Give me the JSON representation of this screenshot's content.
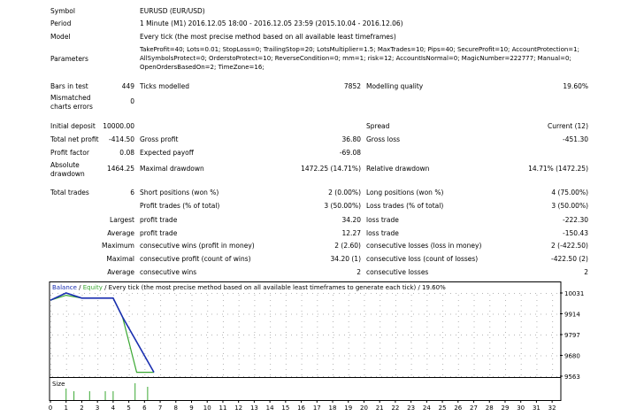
{
  "header": {
    "symbol_label": "Symbol",
    "symbol_value": "EURUSD (EUR/USD)",
    "period_label": "Period",
    "period_value": "1 Minute (M1) 2016.12.05 18:00 - 2016.12.05 23:59 (2015.10.04 - 2016.12.06)",
    "model_label": "Model",
    "model_value": "Every tick (the most precise method based on all available least timeframes)",
    "parameters_label": "Parameters",
    "parameters_value": "TakeProfit=40; Lots=0.01; StopLoss=0; TrailingStop=20; LotsMultiplier=1.5; MaxTrades=10; Pips=40; SecureProfit=10; AccountProtection=1; AllSymbolsProtect=0; OrderstoProtect=10; ReverseCondition=0; mm=1; risk=12; AccountIsNormal=0; MagicNumber=222777; Manual=0; OpenOrdersBasedOn=2; TimeZone=16;"
  },
  "bars": {
    "bars_label": "Bars in test",
    "bars_value": "449",
    "ticks_label": "Ticks modelled",
    "ticks_value": "7852",
    "quality_label": "Modelling quality",
    "quality_value": "19.60%",
    "mismatched_label": "Mismatched charts errors",
    "mismatched_value": "0"
  },
  "stats": {
    "initial_deposit_label": "Initial deposit",
    "initial_deposit_value": "10000.00",
    "spread_label": "Spread",
    "spread_value": "Current (12)",
    "net_profit_label": "Total net profit",
    "net_profit_value": "-414.50",
    "gross_profit_label": "Gross profit",
    "gross_profit_value": "36.80",
    "gross_loss_label": "Gross loss",
    "gross_loss_value": "-451.30",
    "profit_factor_label": "Profit factor",
    "profit_factor_value": "0.08",
    "expected_payoff_label": "Expected payoff",
    "expected_payoff_value": "-69.08",
    "abs_dd_label": "Absolute drawdown",
    "abs_dd_value": "1464.25",
    "max_dd_label": "Maximal drawdown",
    "max_dd_value": "1472.25 (14.71%)",
    "rel_dd_label": "Relative drawdown",
    "rel_dd_value": "14.71% (1472.25)",
    "total_trades_label": "Total trades",
    "total_trades_value": "6",
    "short_label": "Short positions (won %)",
    "short_value": "2 (0.00%)",
    "long_label": "Long positions (won %)",
    "long_value": "4 (75.00%)",
    "profit_trades_label": "Profit trades (% of total)",
    "profit_trades_value": "3 (50.00%)",
    "loss_trades_label": "Loss trades (% of total)",
    "loss_trades_value": "3 (50.00%)",
    "largest_label": "Largest",
    "largest_profit_label": "profit trade",
    "largest_profit_value": "34.20",
    "largest_loss_label": "loss trade",
    "largest_loss_value": "-222.30",
    "average_label": "Average",
    "average_profit_label": "profit trade",
    "average_profit_value": "12.27",
    "average_loss_label": "loss trade",
    "average_loss_value": "-150.43",
    "maximum_label": "Maximum",
    "max_cons_wins_label": "consecutive wins (profit in money)",
    "max_cons_wins_value": "2 (2.60)",
    "max_cons_losses_label": "consecutive losses (loss in money)",
    "max_cons_losses_value": "2 (-422.50)",
    "maximal_label": "Maximal",
    "maximal_cons_profit_label": "consecutive profit (count of wins)",
    "maximal_cons_profit_value": "34.20 (1)",
    "maximal_cons_loss_label": "consecutive loss (count of losses)",
    "maximal_cons_loss_value": "-422.50 (2)",
    "average2_label": "Average",
    "avg_cons_wins_label": "consecutive wins",
    "avg_cons_wins_value": "2",
    "avg_cons_losses_label": "consecutive losses",
    "avg_cons_losses_value": "2"
  },
  "chart_data": {
    "type": "line",
    "legend_balance": "Balance",
    "legend_sep": " / ",
    "legend_equity": "Equity",
    "legend_rest": " / Every tick (the most precise method based on all available least timeframes to generate each tick) / 19.60%",
    "x_ticks": [
      "0",
      "1",
      "2",
      "3",
      "4",
      "5",
      "6",
      "7",
      "8",
      "9",
      "10",
      "11",
      "12",
      "13",
      "14",
      "15",
      "16",
      "17",
      "18",
      "19",
      "20",
      "21",
      "22",
      "23",
      "24",
      "25",
      "26",
      "27",
      "28",
      "29",
      "30",
      "31",
      "32"
    ],
    "y_ticks": [
      "10031",
      "9914",
      "9797",
      "9680",
      "9563"
    ],
    "ylim": [
      9563,
      10031
    ],
    "xlim": [
      0,
      32.5
    ],
    "series": [
      {
        "name": "Balance",
        "x": [
          0,
          1,
          2,
          3,
          4,
          4.6,
          6.6
        ],
        "y": [
          9990,
          10031,
          10002,
          10002,
          10002,
          9896,
          9585
        ]
      },
      {
        "name": "Equity",
        "x": [
          0,
          1,
          2,
          3,
          4,
          4.6,
          5.5,
          6.6
        ],
        "y": [
          9990,
          10018,
          10002,
          10002,
          10002,
          9896,
          9585,
          9585
        ]
      }
    ],
    "size_label": "Size",
    "size_x": [
      1,
      1.5,
      2.5,
      3.5,
      4,
      5.4,
      6.2
    ],
    "size_h": [
      0.65,
      0.5,
      0.5,
      0.5,
      0.5,
      0.95,
      0.75
    ],
    "colors": {
      "balance": "#1a2fb0",
      "equity": "#3aa832",
      "size": "#3aa832",
      "axis": "#000000",
      "grid_dots": "#b4b4b4"
    }
  }
}
